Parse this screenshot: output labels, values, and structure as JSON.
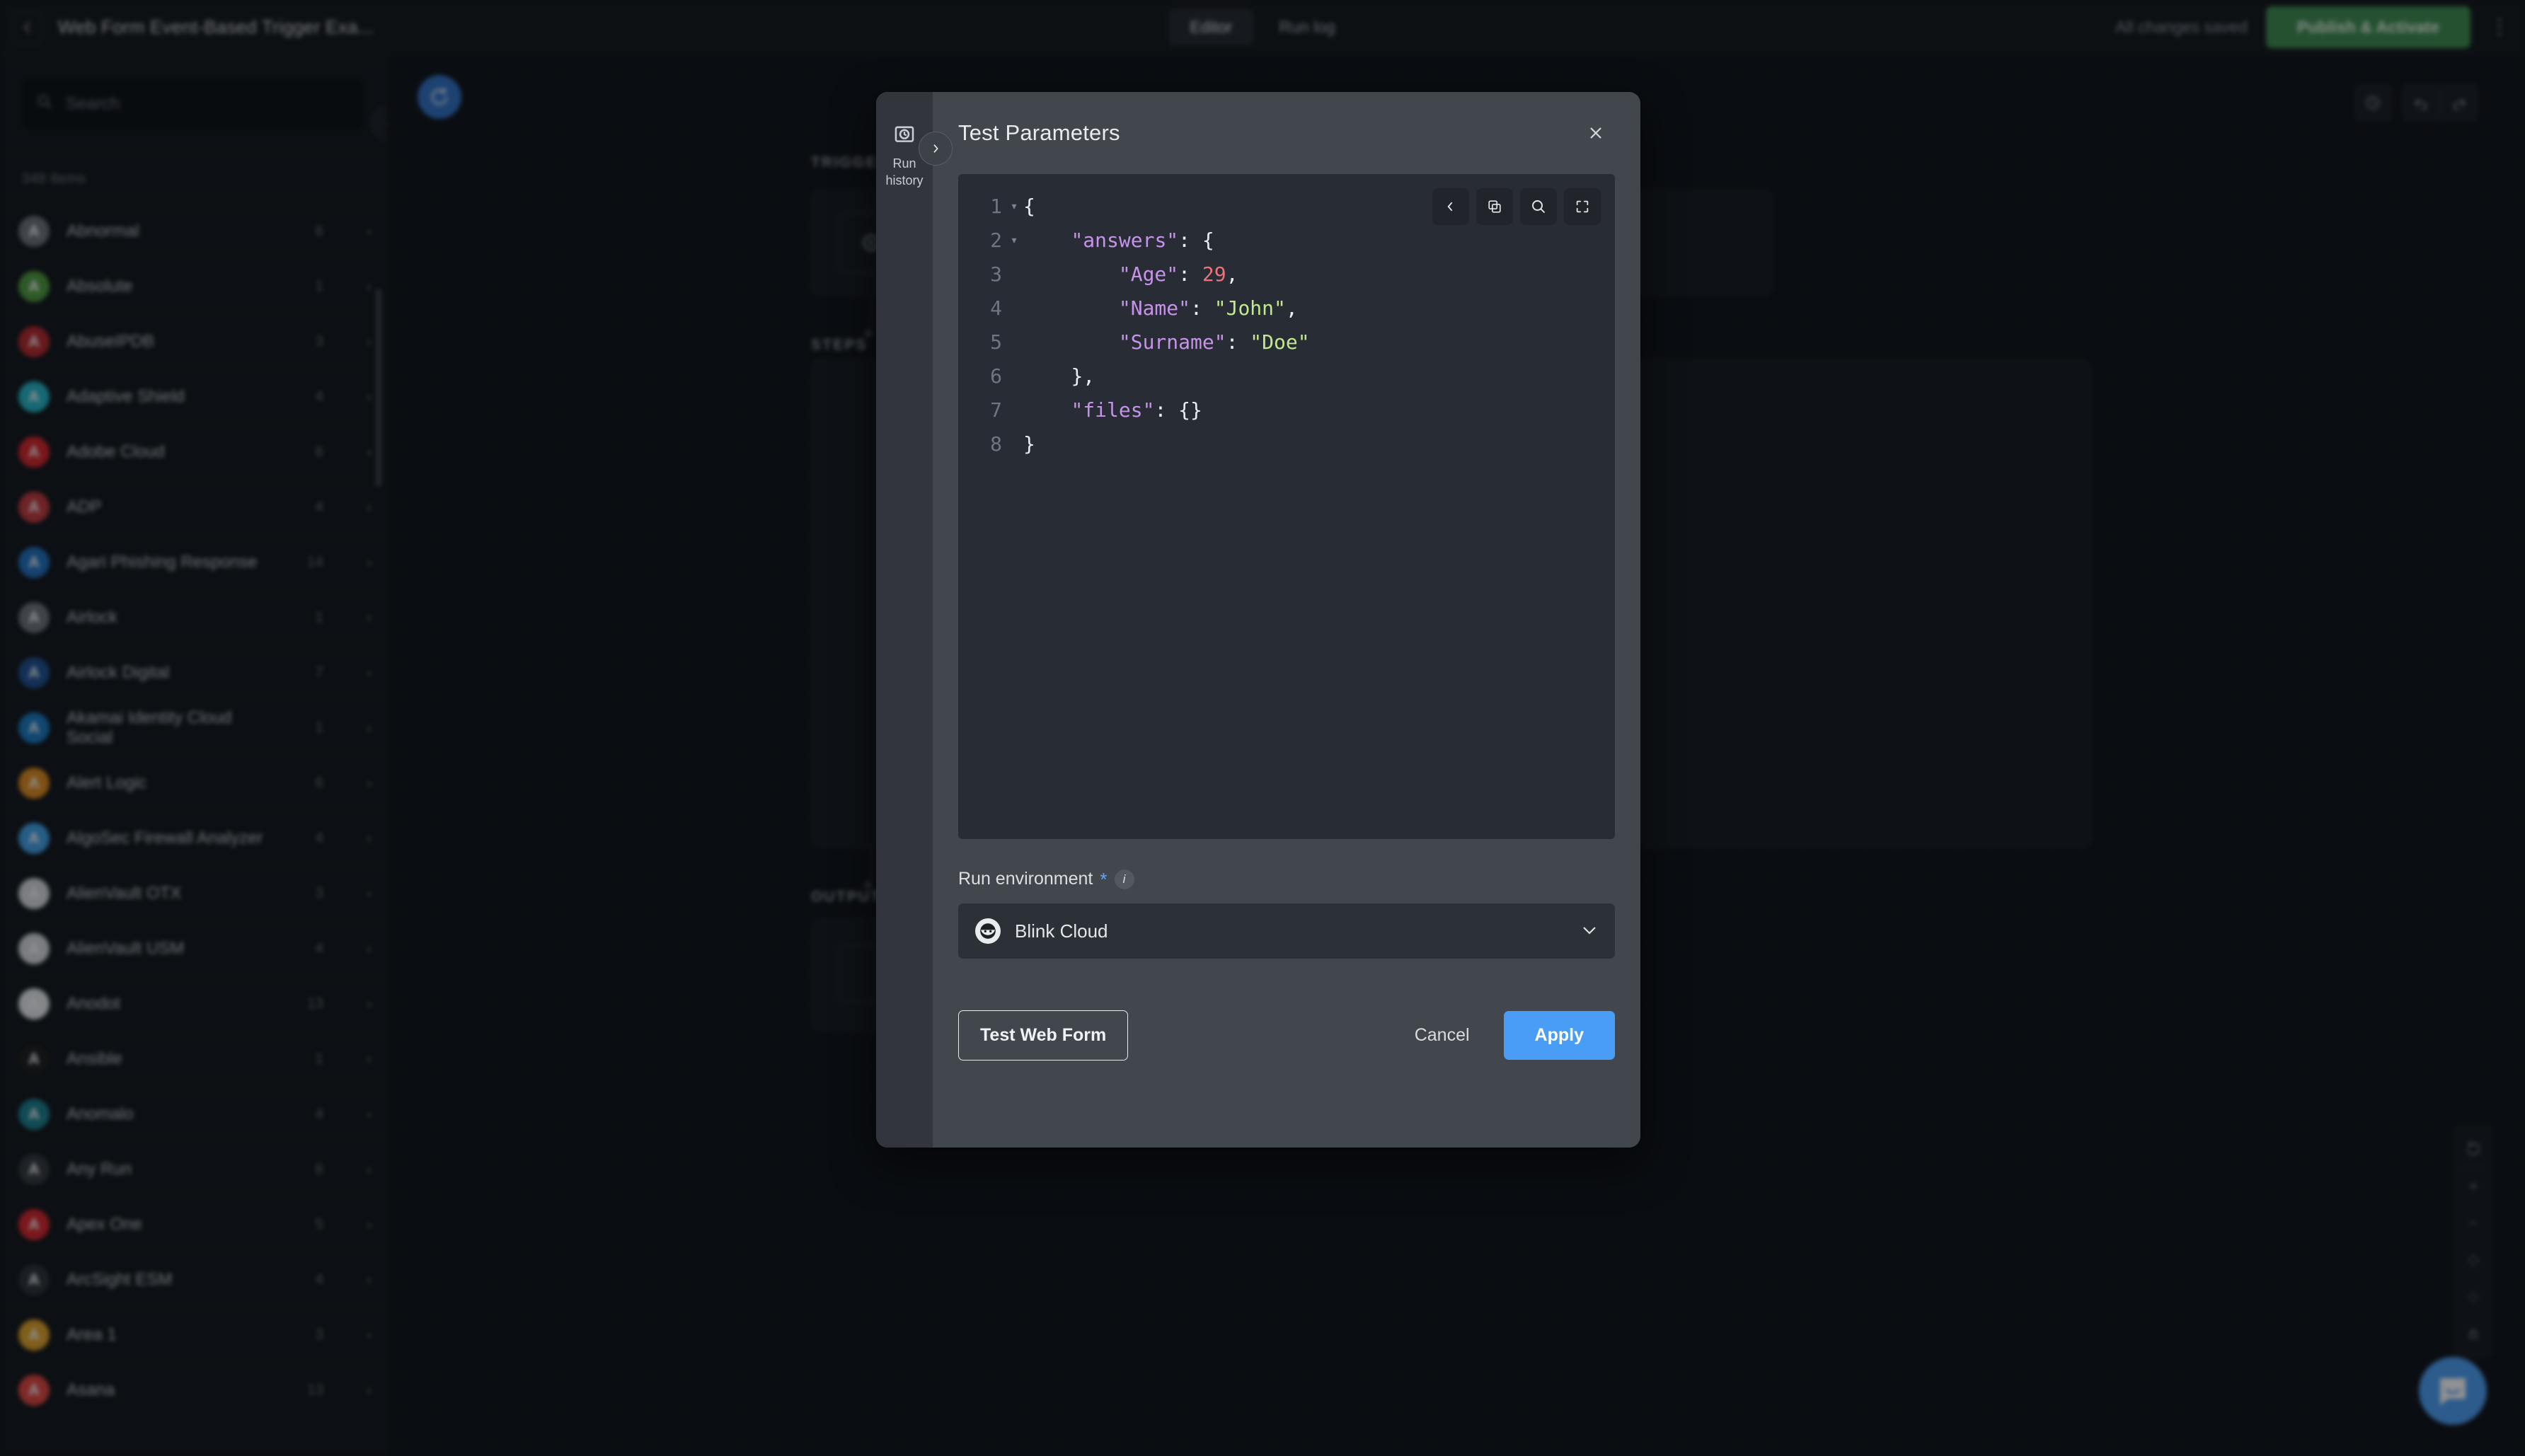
{
  "topbar": {
    "back_icon": "chevron-left-icon",
    "workflow_title": "Web Form Event-Based Trigger Exa...",
    "tabs": [
      {
        "label": "Editor",
        "active": true
      },
      {
        "label": "Run log",
        "active": false
      }
    ],
    "saved_status": "All changes saved",
    "publish_label": "Publish & Activate",
    "menu_icon": "kebab-menu-icon"
  },
  "sidebar": {
    "search_placeholder": "Search",
    "search_icon": "search-icon",
    "items_count": "348 items",
    "collapse_icon": "chevron-left-icon",
    "items": [
      {
        "name": "Abnormal",
        "count": "6",
        "color": "#6c737d"
      },
      {
        "name": "Absolute",
        "count": "1",
        "color": "#4e9a3c"
      },
      {
        "name": "AbuseIPDB",
        "count": "3",
        "color": "#b6272b"
      },
      {
        "name": "Adaptive Shield",
        "count": "4",
        "color": "#22b5c9"
      },
      {
        "name": "Adobe Cloud",
        "count": "6",
        "color": "#d5232a"
      },
      {
        "name": "ADP",
        "count": "4",
        "color": "#c2383c"
      },
      {
        "name": "Agari Phishing Response",
        "count": "14",
        "color": "#1e6fbf"
      },
      {
        "name": "Airlock",
        "count": "1",
        "color": "#6c737d"
      },
      {
        "name": "Airlock Digital",
        "count": "7",
        "color": "#1d4f91"
      },
      {
        "name": "Akamai Identity Cloud Social",
        "count": "1",
        "color": "#1878c2"
      },
      {
        "name": "Alert Logic",
        "count": "6",
        "color": "#e08a1e"
      },
      {
        "name": "AlgoSec Firewall Analyzer",
        "count": "4",
        "color": "#3fa0e8"
      },
      {
        "name": "AlienVault OTX",
        "count": "3",
        "color": "#d8dbe0"
      },
      {
        "name": "AlienVault USM",
        "count": "4",
        "color": "#d8dbe0"
      },
      {
        "name": "Anodot",
        "count": "13",
        "color": "#e9ecef"
      },
      {
        "name": "Ansible",
        "count": "1",
        "color": "#1a1a1a"
      },
      {
        "name": "Anomalo",
        "count": "4",
        "color": "#1a7f8e"
      },
      {
        "name": "Any Run",
        "count": "6",
        "color": "#32363c"
      },
      {
        "name": "Apex One",
        "count": "5",
        "color": "#d6232a"
      },
      {
        "name": "ArcSight ESM",
        "count": "4",
        "color": "#2b2f36"
      },
      {
        "name": "Area 1",
        "count": "3",
        "color": "#e2a226"
      },
      {
        "name": "Asana",
        "count": "13",
        "color": "#e0443e"
      }
    ]
  },
  "canvas": {
    "refresh_icon": "refresh-node-icon",
    "sections": [
      "TRIGGER",
      "STEPS",
      "OUTPUT"
    ],
    "top_controls": [
      "history-icon",
      "undo-icon",
      "redo-icon"
    ],
    "vertical_tools": [
      "reset-icon",
      "zoom-in-icon",
      "zoom-out-icon",
      "fit-view-icon",
      "center-icon",
      "lock-icon"
    ],
    "chat_icon": "intercom-chat-icon"
  },
  "modal": {
    "title": "Test Parameters",
    "close_icon": "close-icon",
    "rail": {
      "icon": "run-history-icon",
      "label_line1": "Run",
      "label_line2": "history",
      "toggle_icon": "chevron-right-icon"
    },
    "editor": {
      "toolbar": [
        {
          "icon": "collapse-left-icon"
        },
        {
          "icon": "copy-icon"
        },
        {
          "icon": "search-icon"
        },
        {
          "icon": "fullscreen-icon"
        }
      ],
      "lines": [
        {
          "n": "1",
          "fold": "▾",
          "tokens": [
            {
              "t": "{",
              "c": "k-pun"
            }
          ],
          "indent": 0
        },
        {
          "n": "2",
          "fold": "▾",
          "tokens": [
            {
              "t": "\"answers\"",
              "c": "k-key"
            },
            {
              "t": ": {",
              "c": "k-pun"
            }
          ],
          "indent": 1
        },
        {
          "n": "3",
          "fold": "",
          "tokens": [
            {
              "t": "\"Age\"",
              "c": "k-key"
            },
            {
              "t": ": ",
              "c": "k-pun"
            },
            {
              "t": "29",
              "c": "k-num"
            },
            {
              "t": ",",
              "c": "k-pun"
            }
          ],
          "indent": 2
        },
        {
          "n": "4",
          "fold": "",
          "tokens": [
            {
              "t": "\"Name\"",
              "c": "k-key"
            },
            {
              "t": ": ",
              "c": "k-pun"
            },
            {
              "t": "\"John\"",
              "c": "k-str"
            },
            {
              "t": ",",
              "c": "k-pun"
            }
          ],
          "indent": 2
        },
        {
          "n": "5",
          "fold": "",
          "tokens": [
            {
              "t": "\"Surname\"",
              "c": "k-key"
            },
            {
              "t": ": ",
              "c": "k-pun"
            },
            {
              "t": "\"Doe\"",
              "c": "k-str"
            }
          ],
          "indent": 2
        },
        {
          "n": "6",
          "fold": "",
          "tokens": [
            {
              "t": "},",
              "c": "k-pun"
            }
          ],
          "indent": 1
        },
        {
          "n": "7",
          "fold": "",
          "tokens": [
            {
              "t": "\"files\"",
              "c": "k-key"
            },
            {
              "t": ": {}",
              "c": "k-pun"
            }
          ],
          "indent": 1
        },
        {
          "n": "8",
          "fold": "",
          "tokens": [
            {
              "t": "}",
              "c": "k-pun"
            }
          ],
          "indent": 0
        }
      ]
    },
    "run_environment": {
      "label": "Run environment",
      "required_mark": "*",
      "info_mark": "i",
      "selected_value": "Blink Cloud",
      "icon": "blink-ninja-icon",
      "chevron_icon": "chevron-down-icon"
    },
    "footer": {
      "test_label": "Test Web Form",
      "cancel_label": "Cancel",
      "apply_label": "Apply"
    }
  },
  "colors": {
    "accent_blue": "#4a9df5",
    "publish_green": "#3d8a4f",
    "modal_bg": "#42464d",
    "rail_bg": "#32363c",
    "editor_bg": "#282c34"
  }
}
